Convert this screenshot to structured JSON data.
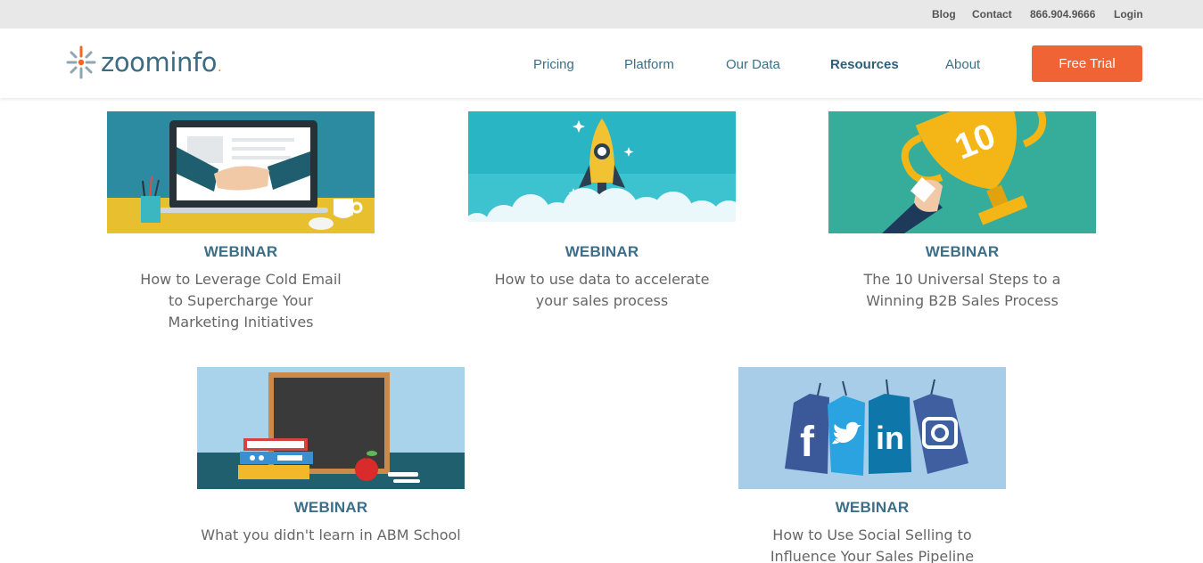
{
  "topbar": {
    "links": [
      "Blog",
      "Contact",
      "866.904.9666",
      "Login"
    ]
  },
  "brand": {
    "name": "zoominfo",
    "accent_color": "#f26522",
    "brand_color": "#3d6b82"
  },
  "nav": {
    "items": [
      "Pricing",
      "Platform",
      "Our Data",
      "Resources",
      "About"
    ],
    "active": "Resources",
    "cta_label": "Free Trial",
    "cta_color": "#ef6334"
  },
  "cards": [
    {
      "kind": "WEBINAR",
      "title": "How to Leverage Cold Email to Supercharge Your Marketing Initiatives",
      "image": "handshake-laptop"
    },
    {
      "kind": "WEBINAR",
      "title": "How to use data to accelerate your sales process",
      "image": "rocket-launch"
    },
    {
      "kind": "WEBINAR",
      "title": "The 10 Universal Steps to a Winning B2B Sales Process",
      "image": "trophy-10"
    },
    {
      "kind": "WEBINAR",
      "title": "What you didn't learn in ABM School",
      "image": "chalkboard-books-apple"
    },
    {
      "kind": "WEBINAR",
      "title": "How to Use Social Selling to Influence Your Sales Pipeline",
      "image": "social-media-tags"
    }
  ],
  "social_tags": [
    "f",
    "twitter",
    "in",
    "instagram"
  ],
  "trophy_number": "10"
}
